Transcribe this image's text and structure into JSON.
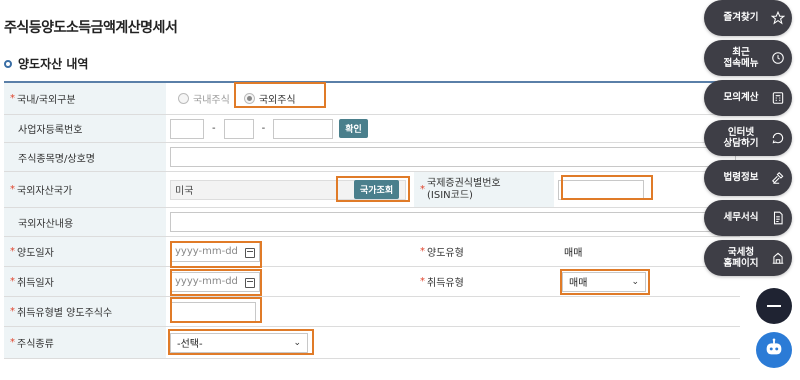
{
  "page": {
    "title": "주식등양도소득금액계산명세서",
    "section_title": "양도자산 내역"
  },
  "rows": {
    "domestic_foreign": {
      "label": "국내/국외구분",
      "required": "*",
      "options": [
        "국내주식",
        "국외주식"
      ],
      "selected": "국외주식"
    },
    "business_reg_no": {
      "label": "사업자등록번호",
      "confirm_button": "확인",
      "dash": "-"
    },
    "stock_name": {
      "label": "주식종목명/상호명"
    },
    "foreign_country": {
      "label": "국외자산국가",
      "required": "*",
      "value": "미국",
      "country_button": "국가조회"
    },
    "isin": {
      "label_line1": "국제증권식별번호",
      "label_line2": "(ISIN코드)",
      "required": "*"
    },
    "foreign_asset_desc": {
      "label": "국외자산내용"
    },
    "transfer_date": {
      "label": "양도일자",
      "required": "*",
      "placeholder": "yyyy-mm-dd"
    },
    "transfer_type": {
      "label": "양도유형",
      "required": "*",
      "value": "매매"
    },
    "acquisition_date": {
      "label": "취득일자",
      "required": "*",
      "placeholder": "yyyy-mm-dd"
    },
    "acquisition_type": {
      "label": "취득유형",
      "required": "*",
      "value": "매매"
    },
    "shares_by_type": {
      "label": "취득유형별 양도주식수",
      "required": "*"
    },
    "stock_type": {
      "label": "주식종류",
      "required": "*",
      "value": "-선택-"
    }
  },
  "sidebar": {
    "items": [
      {
        "label": "즐겨찾기",
        "icon": "star-icon"
      },
      {
        "label": "최근\n접속메뉴",
        "icon": "clock-icon"
      },
      {
        "label": "모의계산",
        "icon": "calculator-icon"
      },
      {
        "label": "인터넷\n상담하기",
        "icon": "chat-icon"
      },
      {
        "label": "법령정보",
        "icon": "gavel-icon"
      },
      {
        "label": "세무서식",
        "icon": "document-icon"
      },
      {
        "label": "국세청\n홈페이지",
        "icon": "building-icon"
      }
    ],
    "collapse_icon": "minus-icon",
    "chatbot_icon": "chatbot-icon"
  },
  "colors": {
    "accent": "#4a7f8c",
    "highlight": "#e07b28",
    "required": "#e0452d",
    "label_bg": "#eef4f6",
    "sidebar_bg": "#3e3e46"
  }
}
